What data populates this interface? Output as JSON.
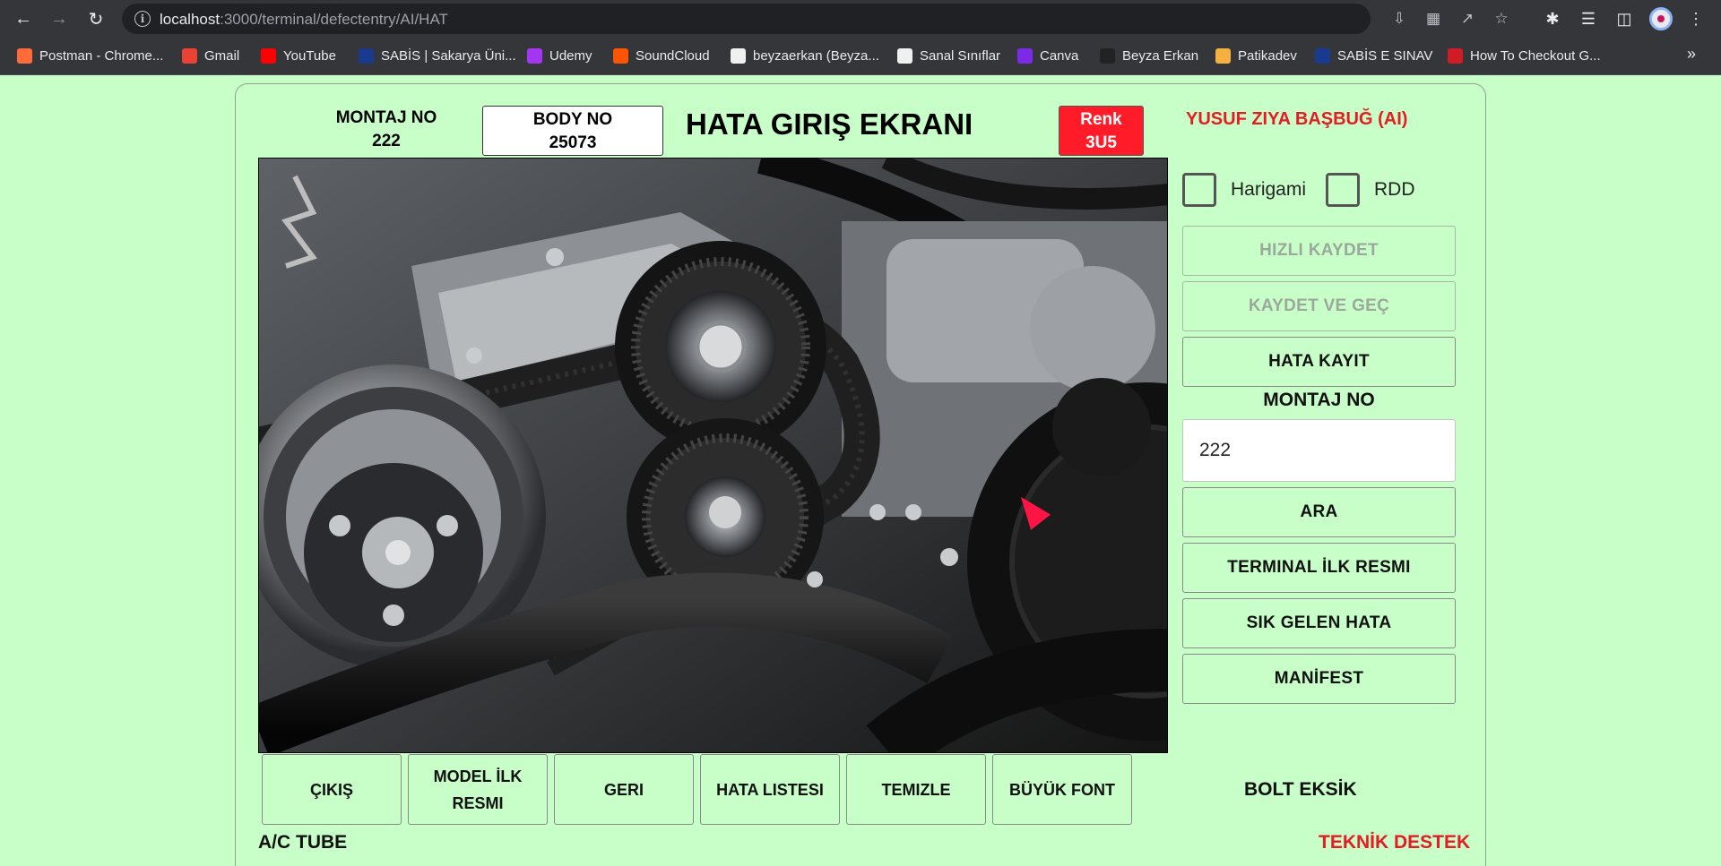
{
  "browser": {
    "url_host": "localhost",
    "url_path": ":3000/terminal/defectentry/AI/HAT",
    "bookmarks": [
      {
        "label": "Postman - Chrome...",
        "color": "#ff6c37"
      },
      {
        "label": "Gmail",
        "color": "#ea4335"
      },
      {
        "label": "YouTube",
        "color": "#ff0000"
      },
      {
        "label": "SABİS | Sakarya Üni...",
        "color": "#1a3a8f"
      },
      {
        "label": "Udemy",
        "color": "#a435f0"
      },
      {
        "label": "SoundCloud",
        "color": "#ff5500"
      },
      {
        "label": "beyzaerkan (Beyza...",
        "color": "#f0f0f0"
      },
      {
        "label": "Sanal Sınıflar",
        "color": "#f0f0f0"
      },
      {
        "label": "Canva",
        "color": "#7d2ae8"
      },
      {
        "label": "Beyza Erkan",
        "color": "#222222"
      },
      {
        "label": "Patikadev",
        "color": "#f5b041"
      },
      {
        "label": "SABİS E SINAV",
        "color": "#1a3a8f"
      },
      {
        "label": "How To Checkout G...",
        "color": "#d01c25"
      }
    ]
  },
  "header": {
    "montaj_label": "MONTAJ NO",
    "montaj_value": "222",
    "body_label": "BODY NO",
    "body_value": "25073",
    "title": "HATA GIRIŞ EKRANI",
    "renk_label": "Renk",
    "renk_value": "3U5",
    "user": "YUSUF ZIYA BAŞBUĞ (AI)"
  },
  "checkboxes": {
    "harigami": "Harigami",
    "rdd": "RDD"
  },
  "side": {
    "quick_save": "HIZLI KAYDET",
    "save_next": "KAYDET VE GEÇ",
    "defect_record": "HATA KAYIT",
    "montaj_label": "MONTAJ NO",
    "montaj_input": "222",
    "search": "ARA",
    "terminal_first_image": "TERMINAL İLK RESMI",
    "frequent_defect": "SIK GELEN HATA",
    "manifest": "MANİFEST"
  },
  "bottom": {
    "exit": "ÇIKIŞ",
    "model_first_image": "MODEL İLK RESMI",
    "back": "GERI",
    "defect_list": "HATA LISTESI",
    "clear": "TEMIZLE",
    "big_font": "BÜYÜK FONT",
    "defect_name": "BOLT EKSİK",
    "part_name": "A/C TUBE",
    "support": "TEKNİK DESTEK"
  },
  "colors": {
    "background": "#c8ffc8",
    "renk_bg": "#ff1c28",
    "alert_red": "#e51c23",
    "marker": "#ff1445"
  }
}
